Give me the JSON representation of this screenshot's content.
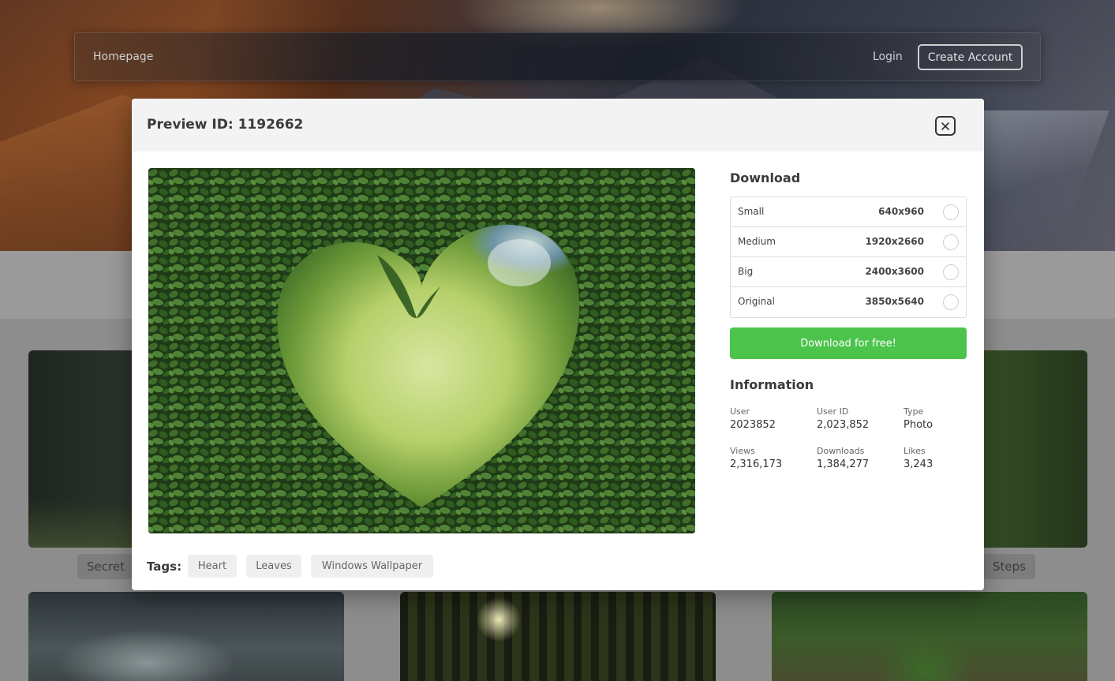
{
  "navbar": {
    "home": "Homepage",
    "login": "Login",
    "create_account": "Create Account"
  },
  "background_tags": [
    "Secret",
    "Steps"
  ],
  "modal": {
    "title": "Preview ID: 1192662",
    "download_heading": "Download",
    "sizes": [
      {
        "name": "Small",
        "dims": "640x960"
      },
      {
        "name": "Medium",
        "dims": "1920x2660"
      },
      {
        "name": "Big",
        "dims": "2400x3600"
      },
      {
        "name": "Original",
        "dims": "3850x5640"
      }
    ],
    "download_button": "Download for free!",
    "info_heading": "Information",
    "info": [
      {
        "label": "User",
        "value": "2023852"
      },
      {
        "label": "User ID",
        "value": "2,023,852"
      },
      {
        "label": "Type",
        "value": "Photo"
      },
      {
        "label": "Views",
        "value": "2,316,173"
      },
      {
        "label": "Downloads",
        "value": "1,384,277"
      },
      {
        "label": "Likes",
        "value": "3,243"
      }
    ],
    "tags_label": "Tags:",
    "tags": [
      "Heart",
      "Leaves",
      "Windows Wallpaper"
    ]
  },
  "colors": {
    "accent_green": "#4cc44c",
    "modal_header_bg": "#f3f3f3",
    "tag_bg": "#efefef"
  },
  "icons": {
    "close": "close-icon",
    "radio": "radio-unchecked-icon"
  }
}
